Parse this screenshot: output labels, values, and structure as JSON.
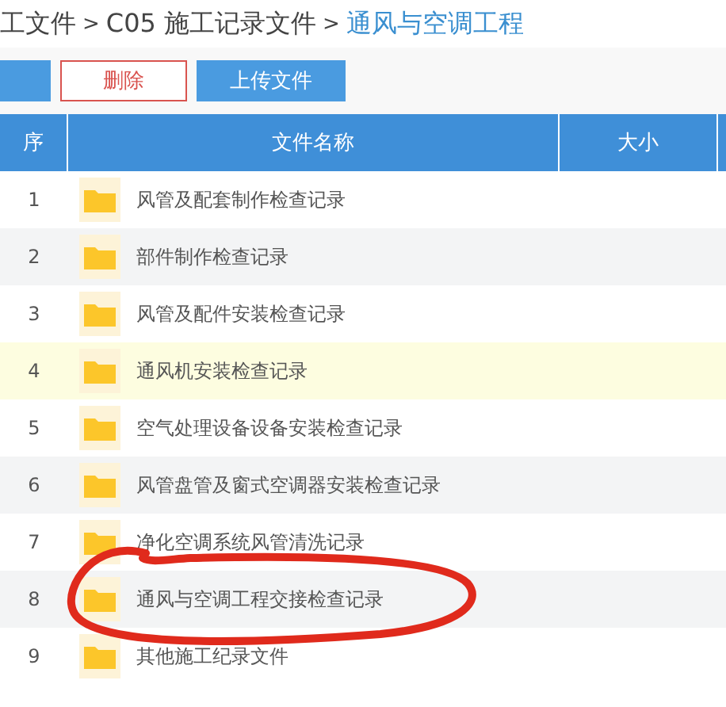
{
  "breadcrumb": [
    {
      "label": "工文件",
      "current": false
    },
    {
      "label": "C05 施工记录文件",
      "current": false
    },
    {
      "label": "通风与空调工程",
      "current": true
    }
  ],
  "breadcrumb_separator": ">",
  "toolbar": [
    {
      "label": "删除",
      "kind": "danger"
    },
    {
      "label": "上传文件",
      "kind": "primary"
    }
  ],
  "table": {
    "columns": [
      "序",
      "文件名称",
      "大小"
    ],
    "rows": [
      {
        "index": "1",
        "name": "风管及配套制作检查记录",
        "selected": false
      },
      {
        "index": "2",
        "name": "部件制作检查记录",
        "selected": false
      },
      {
        "index": "3",
        "name": "风管及配件安装检查记录",
        "selected": false
      },
      {
        "index": "4",
        "name": "通风机安装检查记录",
        "selected": true
      },
      {
        "index": "5",
        "name": "空气处理设备设备安装检查记录",
        "selected": false
      },
      {
        "index": "6",
        "name": "风管盘管及窗式空调器安装检查记录",
        "selected": false
      },
      {
        "index": "7",
        "name": "净化空调系统风管清洗记录",
        "selected": false
      },
      {
        "index": "8",
        "name": "通风与空调工程交接检查记录",
        "selected": false
      },
      {
        "index": "9",
        "name": "其他施工纪录文件",
        "selected": false
      }
    ]
  }
}
